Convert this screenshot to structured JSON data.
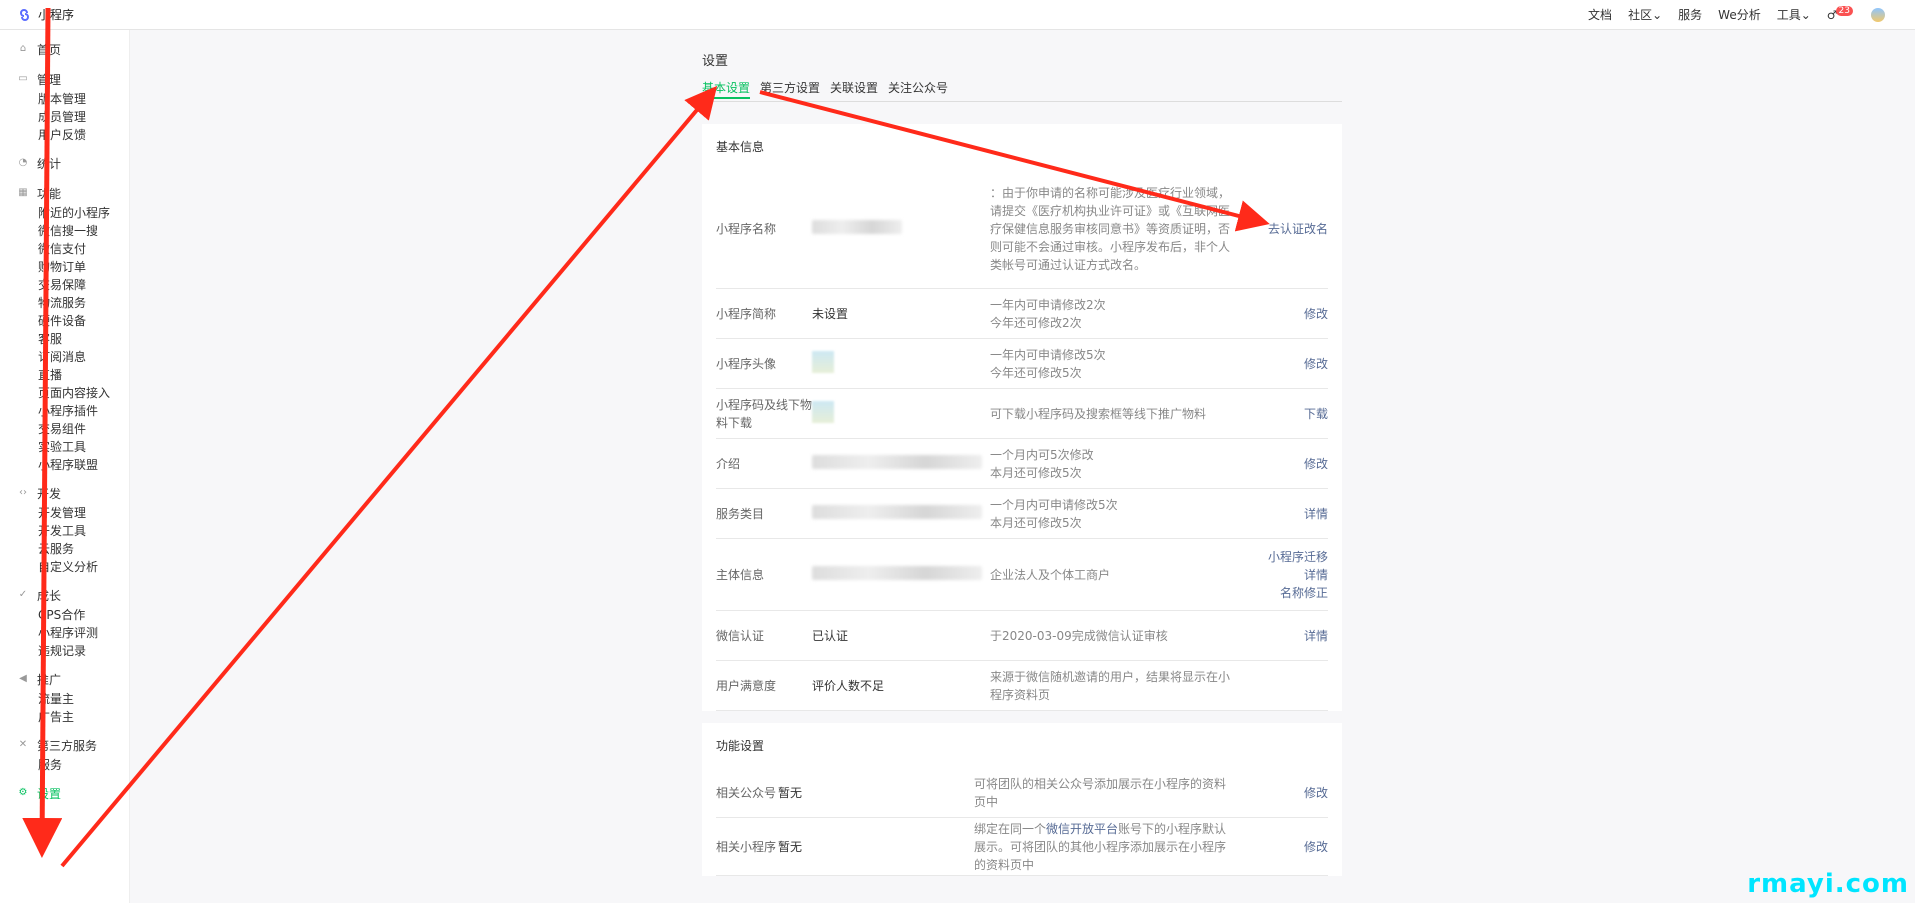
{
  "topbar": {
    "app_name": "小程序",
    "nav": [
      "文档",
      "社区",
      "服务",
      "We分析",
      "工具"
    ],
    "badge_count": "23"
  },
  "sidebar": {
    "groups": [
      {
        "icon": "home-icon",
        "label": "首页",
        "items": []
      },
      {
        "icon": "manage-icon",
        "label": "管理",
        "items": [
          "版本管理",
          "成员管理",
          "用户反馈"
        ]
      },
      {
        "icon": "stats-icon",
        "label": "统计",
        "items": []
      },
      {
        "icon": "grid-icon",
        "label": "功能",
        "items": [
          "附近的小程序",
          "微信搜一搜",
          "微信支付",
          "购物订单",
          "交易保障",
          "物流服务",
          "硬件设备",
          "客服",
          "订阅消息",
          "直播",
          "页面内容接入",
          "小程序插件",
          "交易组件",
          "实验工具",
          "小程序联盟"
        ]
      },
      {
        "icon": "code-icon",
        "label": "开发",
        "items": [
          "开发管理",
          "开发工具",
          "云服务",
          "自定义分析"
        ]
      },
      {
        "icon": "growth-icon",
        "label": "成长",
        "items": [
          "CPS合作",
          "小程序评测",
          "违规记录"
        ]
      },
      {
        "icon": "promo-icon",
        "label": "推广",
        "items": [
          "流量主",
          "广告主"
        ]
      },
      {
        "icon": "thirdparty-icon",
        "label": "第三方服务",
        "items": [
          "服务"
        ]
      },
      {
        "icon": "settings-icon",
        "label": "设置",
        "items": [],
        "active": true
      }
    ]
  },
  "page": {
    "title": "设置",
    "tabs": [
      "基本设置",
      "第三方设置",
      "关联设置",
      "关注公众号"
    ]
  },
  "basic": {
    "title": "基本信息",
    "rows": [
      {
        "label": "小程序名称",
        "value": "",
        "tip": "：由于你申请的名称可能涉及医疗行业领域，请提交《医疗机构执业许可证》或《互联网医疗保健信息服务审核同意书》等资质证明，否则可能不会通过审核。小程序发布后，非个人类帐号可通过认证方式改名。",
        "action": "去认证改名"
      },
      {
        "label": "小程序简称",
        "value": "未设置",
        "tip": "一年内可申请修改2次\n今年还可修改2次",
        "action": "修改"
      },
      {
        "label": "小程序头像",
        "value": "",
        "tip": "一年内可申请修改5次\n今年还可修改5次",
        "action": "修改"
      },
      {
        "label": "小程序码及线下物料下载",
        "value": "",
        "tip": "可下载小程序码及搜索框等线下推广物料",
        "action": "下载"
      },
      {
        "label": "介绍",
        "value": "",
        "tip": "一个月内可5次修改\n本月还可修改5次",
        "action": "修改"
      },
      {
        "label": "服务类目",
        "value": "",
        "tip": "一个月内可申请修改5次\n本月还可修改5次",
        "action": "详情"
      },
      {
        "label": "主体信息",
        "value": "",
        "tip": "企业法人及个体工商户",
        "action": "小程序迁移\n详情\n名称修正"
      },
      {
        "label": "微信认证",
        "value": "已认证",
        "tip": "于2020-03-09完成微信认证审核",
        "action": "详情"
      },
      {
        "label": "用户满意度",
        "value": "评价人数不足",
        "tip": "来源于微信随机邀请的用户，结果将显示在小程序资料页",
        "action": ""
      }
    ]
  },
  "features": {
    "title": "功能设置",
    "rows": [
      {
        "label": "相关公众号",
        "value": "暂无",
        "tip": "可将团队的相关公众号添加展示在小程序的资料页中",
        "action": "修改"
      },
      {
        "label": "相关小程序",
        "value": "暂无",
        "tip_pre": "绑定在同一个",
        "tip_link": "微信开放平台",
        "tip_post": "账号下的小程序默认展示。可将团队的其他小程序添加展示在小程序的资料页中",
        "action": "修改"
      }
    ]
  },
  "watermark": "rmayi.com",
  "colors": {
    "accent": "#07c160",
    "link": "#576b95",
    "arrow": "#ff2a1a",
    "watermark": "#00e5ff"
  }
}
